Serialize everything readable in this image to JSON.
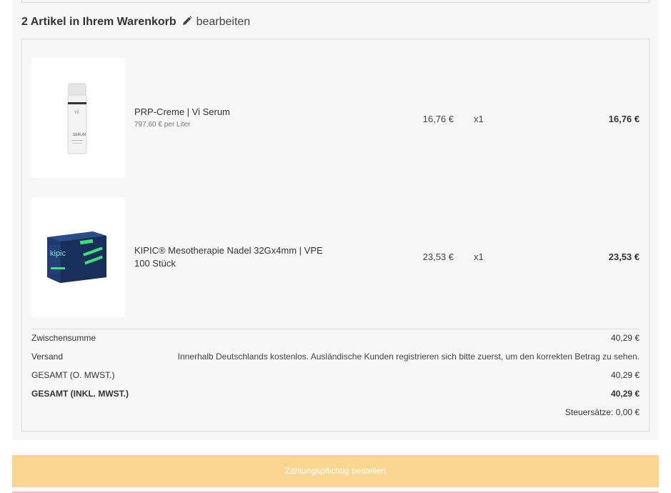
{
  "cart": {
    "count_label": "2 Artikel in Ihrem Warenkorb",
    "edit_label": "bearbeiten",
    "items": [
      {
        "name": "PRP-Creme | Vi Serum",
        "unit_price_info": "797,60 € per Liter",
        "price": "16,76 €",
        "quantity": "x1",
        "total": "16,76 €",
        "image_icon": "serum-bottle-image"
      },
      {
        "name": "KIPIC® Mesotherapie Nadel 32Gx4mm | VPE 100 Stück",
        "price": "23,53 €",
        "quantity": "x1",
        "total": "23,53 €",
        "image_icon": "needle-box-image"
      }
    ]
  },
  "summary": {
    "subtotal_label": "Zwischensumme",
    "subtotal_value": "40,29 €",
    "shipping_label": "Versand",
    "shipping_value": "Innerhalb Deutschlands kostenlos. Ausländische Kunden registrieren sich bitte zuerst, um den korrekten Betrag zu sehen.",
    "net_label": "GESAMT (O. MWST.)",
    "net_value": "40,29 €",
    "gross_label": "GESAMT (INKL. MWST.)",
    "gross_value": "40,29 €",
    "tax_label": "Steuersätze: 0,00 €"
  },
  "checkout": {
    "button_label": "Zahlungspflichtig bestellen"
  },
  "colors": {
    "panel_bg": "#f7f7f7",
    "button_bg": "#fbd691",
    "button_text": "#ffffff",
    "border": "#dddddd"
  }
}
